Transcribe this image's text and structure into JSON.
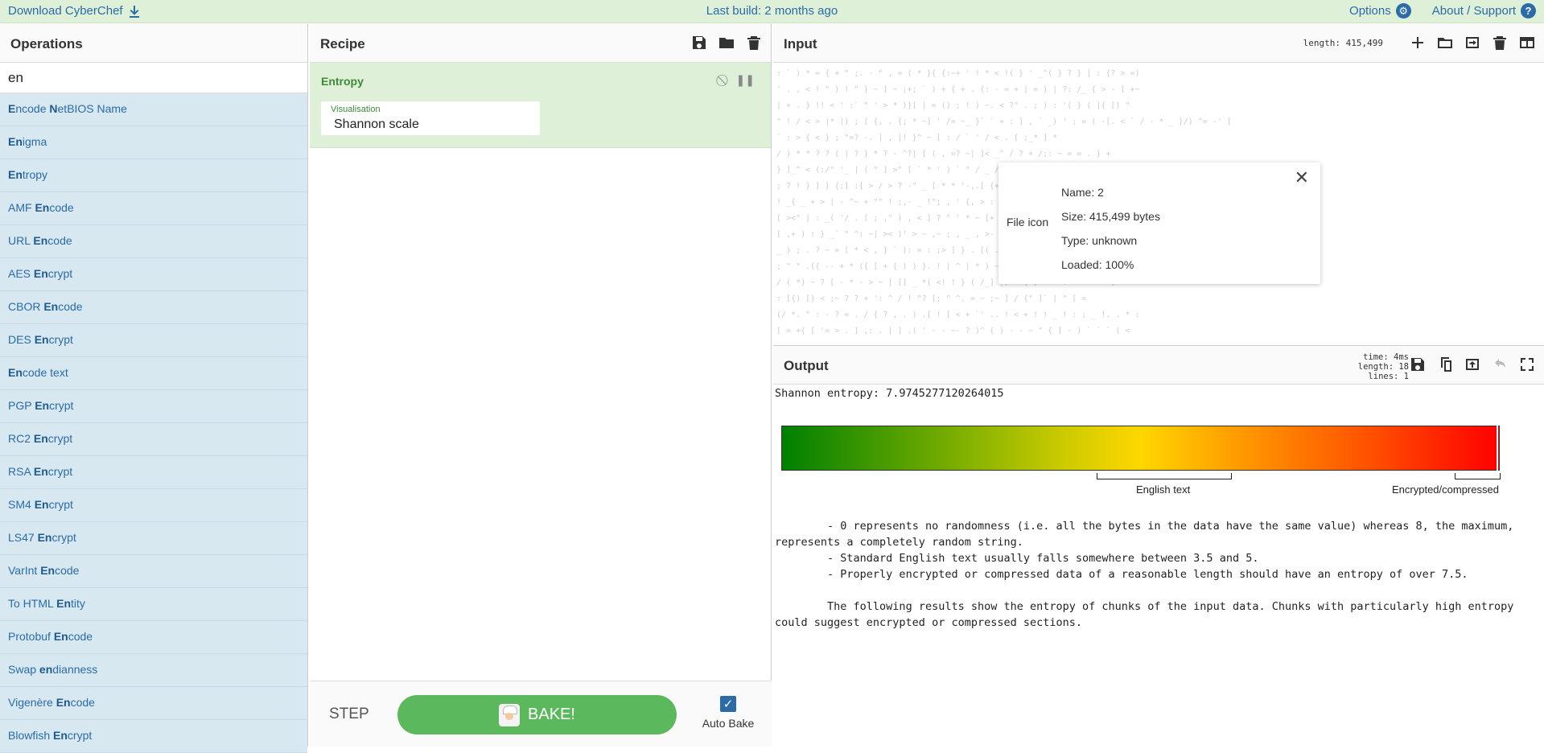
{
  "banner": {
    "download": "Download CyberChef",
    "last_build": "Last build: 2 months ago",
    "options": "Options",
    "about": "About / Support"
  },
  "operations": {
    "title": "Operations",
    "search_value": "en",
    "items": [
      {
        "pre": "",
        "hl": "E",
        "mid": "ncode N",
        "hl2": "",
        "post": "etBIOS Name"
      },
      {
        "pre": "",
        "hl": "En",
        "post": "igma"
      },
      {
        "pre": "",
        "hl": "En",
        "post": "tropy"
      },
      {
        "pre": "AMF ",
        "hl": "En",
        "post": "code"
      },
      {
        "pre": "URL ",
        "hl": "En",
        "post": "code"
      },
      {
        "pre": "AES ",
        "hl": "En",
        "post": "crypt"
      },
      {
        "pre": "CBOR ",
        "hl": "En",
        "post": "code"
      },
      {
        "pre": "DES ",
        "hl": "En",
        "post": "crypt"
      },
      {
        "pre": "",
        "hl": "En",
        "post": "code text"
      },
      {
        "pre": "PGP ",
        "hl": "En",
        "post": "crypt"
      },
      {
        "pre": "RC2 ",
        "hl": "En",
        "post": "crypt"
      },
      {
        "pre": "RSA ",
        "hl": "En",
        "post": "crypt"
      },
      {
        "pre": "SM4 ",
        "hl": "En",
        "post": "crypt"
      },
      {
        "pre": "LS47 ",
        "hl": "En",
        "post": "crypt"
      },
      {
        "pre": "VarInt ",
        "hl": "En",
        "post": "code"
      },
      {
        "pre": "To HTML ",
        "hl": "En",
        "post": "tity"
      },
      {
        "pre": "Protobuf ",
        "hl": "En",
        "post": "code"
      },
      {
        "pre": "Swap ",
        "hl": "en",
        "post": "dianness"
      },
      {
        "pre": "Vigenère ",
        "hl": "En",
        "post": "code"
      },
      {
        "pre": "Blowfish ",
        "hl": "En",
        "post": "crypt"
      }
    ]
  },
  "recipe": {
    "title": "Recipe",
    "op_name": "Entropy",
    "field_label": "Visualisation",
    "field_value": "Shannon scale",
    "step": "STEP",
    "bake": "BAKE!",
    "autobake": "Auto Bake"
  },
  "input": {
    "title": "Input",
    "length": "length: 415,499",
    "file": {
      "icon_label": "File icon",
      "name": "Name: 2",
      "size": "Size: 415,499 bytes",
      "type": "Type: unknown",
      "loaded": "Loaded: 100%"
    }
  },
  "output": {
    "title": "Output",
    "time": "time:   4ms",
    "length": "length:   18",
    "lines": "lines:    1",
    "entropy_line": "Shannon entropy: 7.9745277120264015",
    "entropy_value": 7.9745277120264015,
    "scale_max": 8,
    "label_english": "English text",
    "label_encrypted": "Encrypted/compressed",
    "description": "        - 0 represents no randomness (i.e. all the bytes in the data have the same value) whereas 8, the maximum,\nrepresents a completely random string.\n        - Standard English text usually falls somewhere between 3.5 and 5.\n        - Properly encrypted or compressed data of a reasonable length should have an entropy of over 7.5.\n\n        The following results show the entropy of chunks of the input data. Chunks with particularly high entropy\ncould suggest encrypted or compressed sections."
  }
}
